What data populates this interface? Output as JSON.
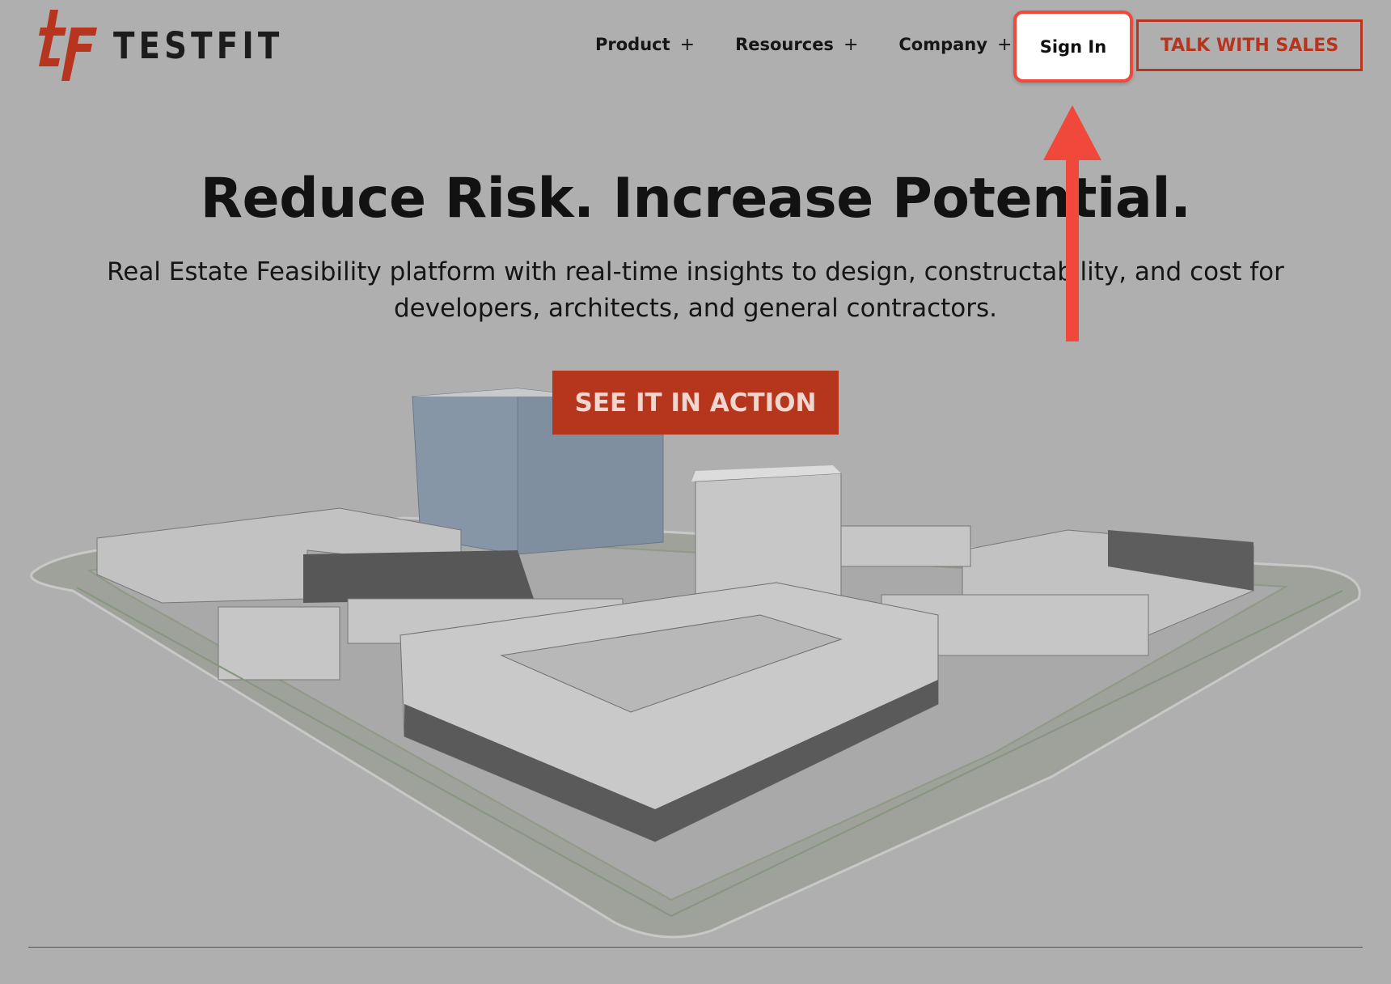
{
  "brand": {
    "name": "TESTFIT",
    "accent": "#b7351f",
    "highlight": "#f0483a"
  },
  "nav": {
    "items": [
      {
        "label": "Product",
        "icon": "plus-icon"
      },
      {
        "label": "Resources",
        "icon": "plus-icon"
      },
      {
        "label": "Company",
        "icon": "plus-icon"
      }
    ],
    "sign_in": "Sign In",
    "talk_with_sales": "TALK WITH SALES"
  },
  "hero": {
    "title": "Reduce Risk. Increase Potential.",
    "subtitle": "Real Estate Feasibility platform with real-time insights to design, constructability, and cost for developers, architects, and general contractors.",
    "cta": "SEE IT IN ACTION"
  },
  "annotation": {
    "icon": "arrow-up-icon",
    "target": "Sign In"
  }
}
